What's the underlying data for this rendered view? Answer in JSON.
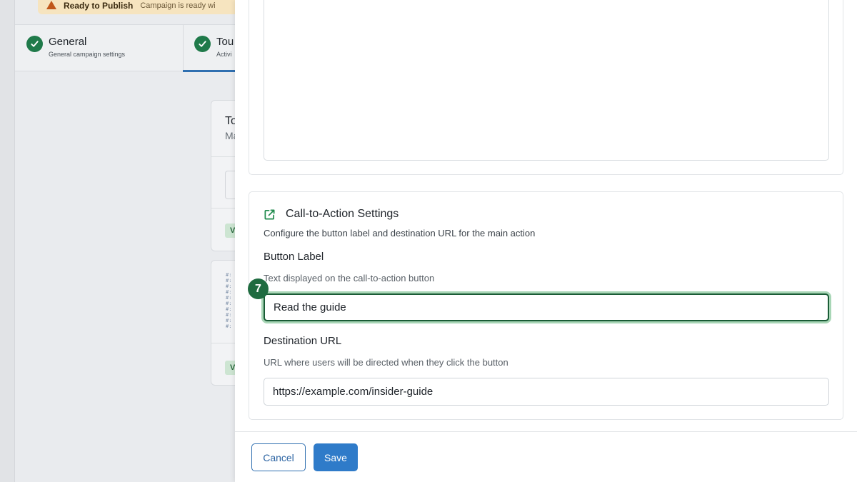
{
  "background": {
    "banner": {
      "title": "Ready to Publish",
      "message": "Campaign is ready wi"
    },
    "steps": [
      {
        "title": "General",
        "subtitle": "General campaign settings"
      },
      {
        "title": "Tou",
        "subtitle": "Activi"
      }
    ],
    "card": {
      "title": "To",
      "subtitle": "Ma",
      "tag": "V"
    }
  },
  "cta": {
    "title": "Call-to-Action Settings",
    "description": "Configure the button label and destination URL for the main action",
    "button_label": {
      "label": "Button Label",
      "help": "Text displayed on the call-to-action button",
      "value": "Read the guide"
    },
    "destination_url": {
      "label": "Destination URL",
      "help": "URL where users will be directed when they click the button",
      "value": "https://example.com/insider-guide"
    }
  },
  "step_badge": "7",
  "footer": {
    "cancel_label": "Cancel",
    "save_label": "Save"
  },
  "colors": {
    "accent": "#2f7bc9",
    "focus": "#1a5c36",
    "success": "#1f7a4a"
  }
}
